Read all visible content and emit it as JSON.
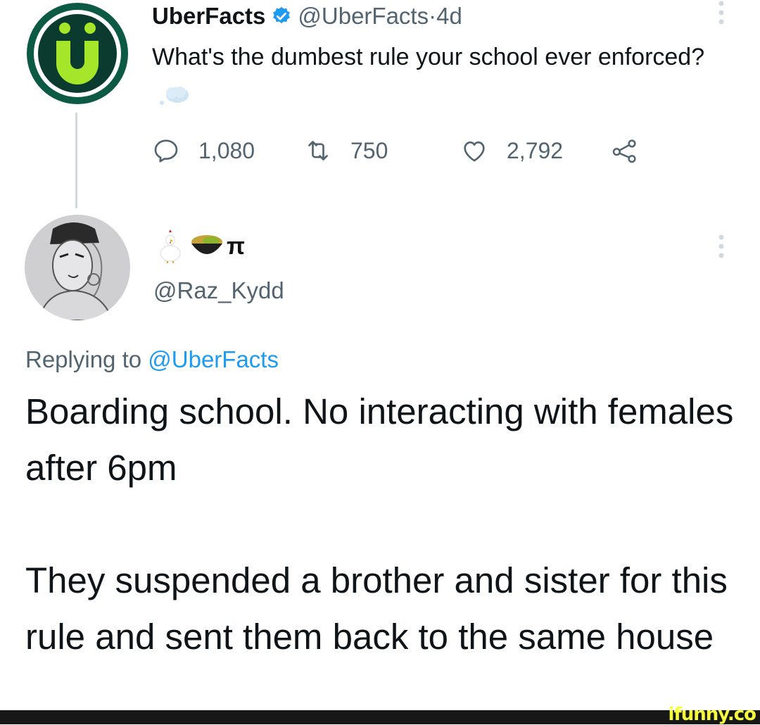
{
  "tweet": {
    "author_name": "UberFacts",
    "author_handle": "@UberFacts",
    "time_sep": " · ",
    "time": "4d",
    "text": "What's the dumbest rule your school ever enforced?",
    "avatar_icon": "uberfacts-logo-icon",
    "stats": {
      "replies": "1,080",
      "retweets": "750",
      "likes": "2,792"
    }
  },
  "reply": {
    "display_name_symbol": "π",
    "handle": "@Raz_Kydd",
    "replying_to_label": "Replying to ",
    "replying_to_handle": "@UberFacts",
    "text_paragraphs": [
      "Boarding school. No interacting with females after 6pm",
      "They suspended a brother and sister for this rule and sent them back to the same house"
    ]
  },
  "watermark": "ifunny.co",
  "colors": {
    "text": "#0f1419",
    "secondary": "#536471",
    "link": "#1d9bf0",
    "verified": "#1d9bf0",
    "logo_green": "#a6e62a",
    "logo_dark": "#0d5a44"
  }
}
